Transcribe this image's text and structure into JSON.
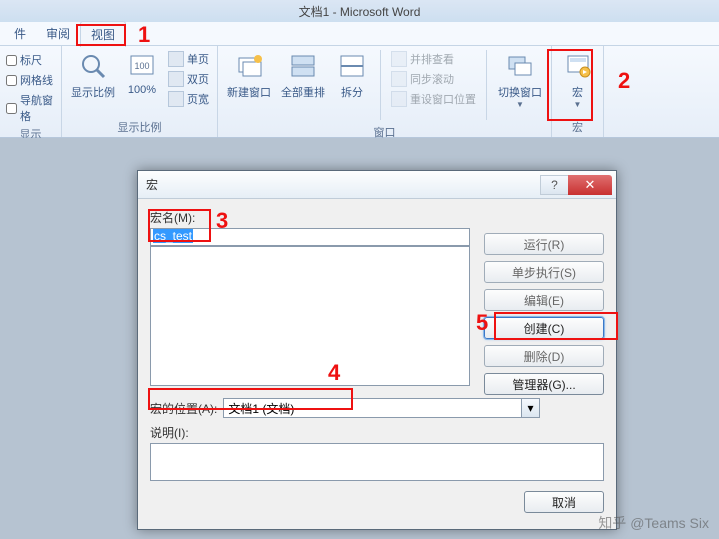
{
  "app_title": "文档1 - Microsoft Word",
  "tabs": {
    "t1": "件",
    "t2": "审阅",
    "t3": "视图"
  },
  "annotations": {
    "a1": "1",
    "a2": "2",
    "a3": "3",
    "a4": "4",
    "a5": "5"
  },
  "ribbon": {
    "show_group": {
      "ruler": "标尺",
      "grid": "网格线",
      "nav": "导航窗格",
      "label": "显示"
    },
    "zoom_group": {
      "zoom_ratio": "显示比例",
      "hundred": "100%",
      "one_page": "单页",
      "two_page": "双页",
      "page_width": "页宽",
      "label": "显示比例"
    },
    "window_group": {
      "new_win": "新建窗口",
      "arrange": "全部重排",
      "split": "拆分",
      "side_by_side": "并排查看",
      "sync_scroll": "同步滚动",
      "reset_pos": "重设窗口位置",
      "switch_win": "切换窗口",
      "label": "窗口"
    },
    "macro_group": {
      "macro": "宏",
      "label": "宏"
    }
  },
  "dialog": {
    "title": "宏",
    "name_label": "宏名(M):",
    "name_value": "cs_test",
    "run": "运行(R)",
    "step": "单步执行(S)",
    "edit": "编辑(E)",
    "create": "创建(C)",
    "delete": "删除(D)",
    "organizer": "管理器(G)...",
    "location_label": "宏的位置(A):",
    "location_value": "文档1 (文档)",
    "desc_label": "说明(I):",
    "cancel": "取消"
  },
  "watermark": "知乎 @Teams Six"
}
